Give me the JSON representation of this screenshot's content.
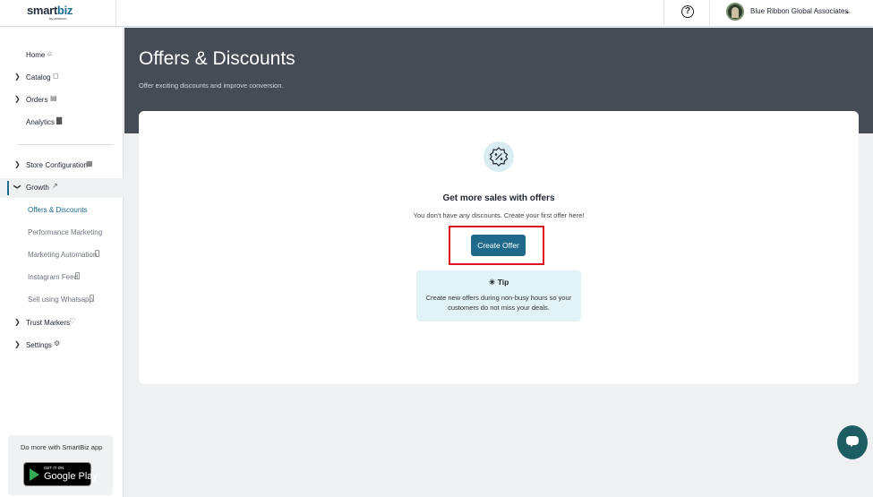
{
  "brand": {
    "name_main": "smart",
    "name_accent": "biz",
    "by": "by amazon"
  },
  "topbar": {
    "help_icon": "question-circle-icon",
    "account_name": "Blue Ribbon Global Associates"
  },
  "sidebar": {
    "items": [
      {
        "label": "Home",
        "icon": "home-icon",
        "expandable": false
      },
      {
        "label": "Catalog",
        "icon": "box-icon",
        "expandable": true
      },
      {
        "label": "Orders",
        "icon": "clipboard-icon",
        "expandable": true
      },
      {
        "label": "Analytics",
        "icon": "bar-chart-icon",
        "expandable": false
      },
      {
        "label": "Store Configuration",
        "icon": "store-icon",
        "expandable": true
      },
      {
        "label": "Growth",
        "icon": "trend-up-icon",
        "expandable": true,
        "expanded": true
      },
      {
        "label": "Trust Markers",
        "icon": "shield-icon",
        "expandable": true
      },
      {
        "label": "Settings",
        "icon": "gear-icon",
        "expandable": true
      }
    ],
    "growth_subitems": [
      {
        "label": "Offers & Discounts",
        "current": true
      },
      {
        "label": "Performance Marketing"
      },
      {
        "label": "Marketing Automation",
        "icon": "external-icon"
      },
      {
        "label": "Instagram Feed",
        "icon": "external-icon"
      },
      {
        "label": "Sell using Whatsapp",
        "icon": "external-icon"
      }
    ],
    "promo_text": "Do more with SmartBiz app",
    "play_small": "GET IT ON",
    "play_big": "Google Play"
  },
  "page": {
    "title": "Offers & Discounts",
    "subtitle": "Offer exciting discounts and improve conversion."
  },
  "empty_state": {
    "title": "Get more sales with offers",
    "text": "You don't have any discounts. Create your first offer here!",
    "button": "Create Offer"
  },
  "tip": {
    "heading": "Tip",
    "body": "Create new offers during non-busy hours so your customers do not miss your deals."
  },
  "colors": {
    "accent": "#1f6a8a",
    "header": "#464c56",
    "highlight": "#e0141c",
    "tip_bg": "#e1f3f6"
  }
}
